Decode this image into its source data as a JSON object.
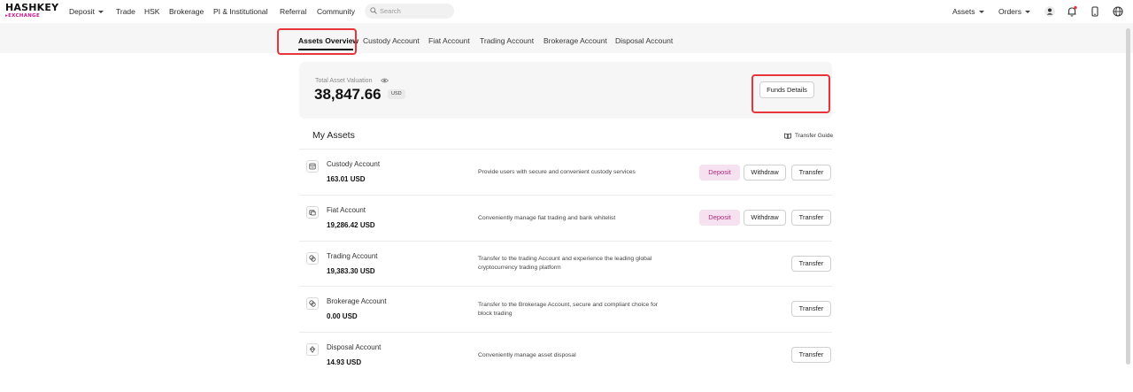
{
  "header": {
    "logo_top": "HASHKEY",
    "logo_bottom": "EXCHANGE",
    "nav": [
      {
        "label": "Deposit"
      },
      {
        "label": "Trade"
      },
      {
        "label": "HSK"
      },
      {
        "label": "Brokerage"
      },
      {
        "label": "PI & Institutional"
      },
      {
        "label": "Referral"
      },
      {
        "label": "Community"
      }
    ],
    "search_placeholder": "Search",
    "assets_label": "Assets",
    "orders_label": "Orders",
    "icons": [
      "search-icon",
      "user-icon",
      "bell-icon",
      "phone-icon",
      "globe-icon"
    ],
    "notification_color": "#e8353b"
  },
  "tabs": [
    {
      "label": "Assets Overview",
      "active": true
    },
    {
      "label": "Custody Account"
    },
    {
      "label": "Fiat Account"
    },
    {
      "label": "Trading Account"
    },
    {
      "label": "Brokerage Account"
    },
    {
      "label": "Disposal Account"
    }
  ],
  "valuation": {
    "label": "Total Asset Valuation",
    "amount": "38,847.66",
    "currency": "USD",
    "funds_details_label": "Funds Details"
  },
  "my_assets": {
    "title": "My Assets",
    "transfer_guide_label": "Transfer Guide",
    "accounts": [
      {
        "name": "Custody Account",
        "amount": "163.01 USD",
        "description": "Provide users with secure and convenient custody services",
        "deposit": "Deposit",
        "withdraw": "Withdraw",
        "transfer": "Transfer"
      },
      {
        "name": "Fiat Account",
        "amount": "19,286.42 USD",
        "description": "Conveniently manage fiat trading and bank whitelist",
        "deposit": "Deposit",
        "withdraw": "Withdraw",
        "transfer": "Transfer"
      },
      {
        "name": "Trading Account",
        "amount": "19,383.30 USD",
        "description": "Transfer to the trading Account and experience the leading global cryptocurrency trading platform",
        "transfer": "Transfer"
      },
      {
        "name": "Brokerage Account",
        "amount": "0.00 USD",
        "description": "Transfer to the Brokerage Account, secure and compliant choice for block trading",
        "transfer": "Transfer"
      },
      {
        "name": "Disposal Account",
        "amount": "14.93 USD",
        "description": "Conveniently manage asset disposal",
        "transfer": "Transfer"
      }
    ]
  },
  "colors": {
    "brand": "#c2188c",
    "deposit_bg": "#f5e1ef",
    "deposit_text": "#b3287f",
    "highlight": "#e8353b"
  }
}
